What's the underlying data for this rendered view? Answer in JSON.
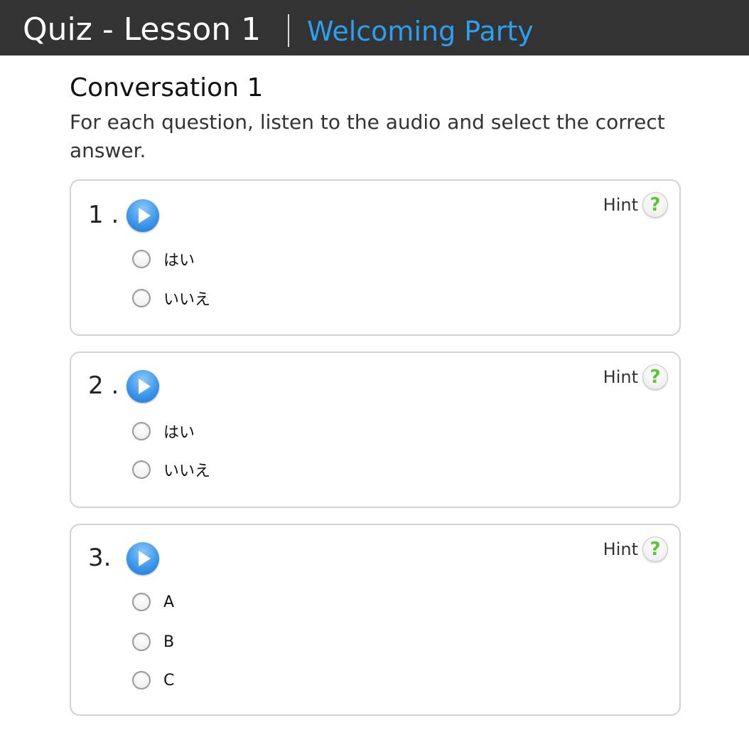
{
  "header": {
    "title": "Quiz - Lesson 1",
    "subtitle": "Welcoming Party"
  },
  "section": {
    "title": "Conversation 1",
    "instructions": "For each question, listen to the audio and select the correct answer."
  },
  "hint_label": "Hint",
  "hint_symbol": "?",
  "questions": [
    {
      "number": "1 .",
      "options": [
        "はい",
        "いいえ"
      ]
    },
    {
      "number": "2 .",
      "options": [
        "はい",
        "いいえ"
      ]
    },
    {
      "number": "3.",
      "options": [
        "A",
        "B",
        "C"
      ]
    }
  ],
  "icons": {
    "play": "play-icon",
    "hint": "help-icon",
    "radio": "radio-button"
  },
  "colors": {
    "header_bg": "#333333",
    "accent_blue": "#2b9ff0",
    "hint_green": "#5cc536",
    "card_border": "#d3d3d3"
  }
}
